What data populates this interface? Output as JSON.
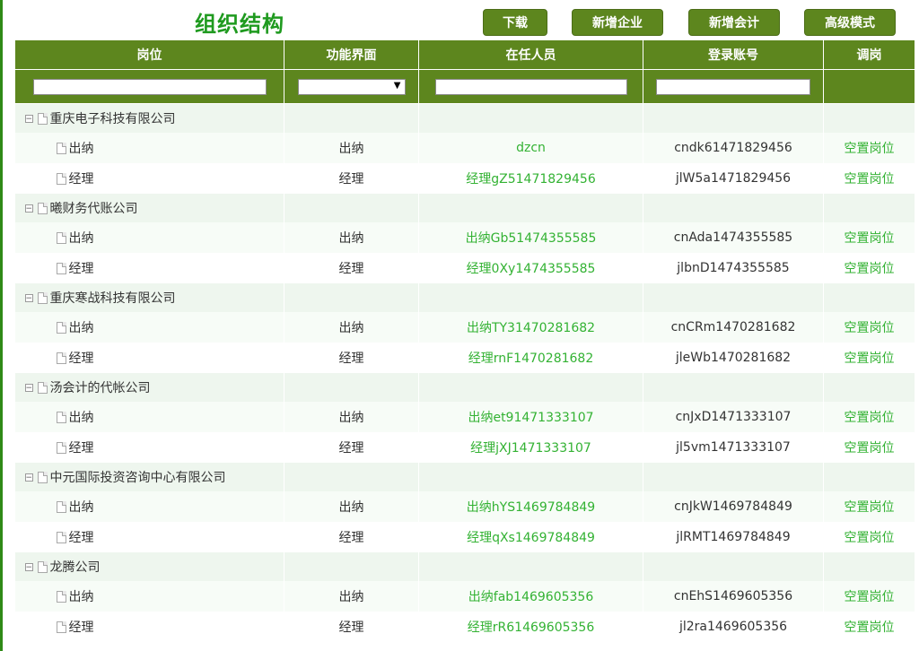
{
  "title": "组织结构",
  "toolbar": {
    "download": "下载",
    "new_company": "新增企业",
    "new_accountant": "新增会计",
    "advanced_mode": "高级模式"
  },
  "colors": {
    "header_bg": "#5d861e",
    "accent_green": "#33b233",
    "title_green": "#1f9a1f"
  },
  "columns": [
    "岗位",
    "功能界面",
    "在任人员",
    "登录账号",
    "调岗"
  ],
  "filters": {
    "position": "",
    "function": "",
    "staff": "",
    "account": ""
  },
  "icons": {
    "tree_toggle": "minus-box-icon",
    "node": "document-icon",
    "dropdown": "caret-down-icon"
  },
  "companies": [
    {
      "name": "重庆电子科技有限公司",
      "roles": [
        {
          "position": "出纳",
          "function": "出纳",
          "staff": "dzcn",
          "account": "cndk61471829456",
          "action": "空置岗位"
        },
        {
          "position": "经理",
          "function": "经理",
          "staff": "经理gZ51471829456",
          "account": "jlW5a1471829456",
          "action": "空置岗位"
        }
      ]
    },
    {
      "name": "曦财务代账公司",
      "roles": [
        {
          "position": "出纳",
          "function": "出纳",
          "staff": "出纳Gb51474355585",
          "account": "cnAda1474355585",
          "action": "空置岗位"
        },
        {
          "position": "经理",
          "function": "经理",
          "staff": "经理0Xy1474355585",
          "account": "jlbnD1474355585",
          "action": "空置岗位"
        }
      ]
    },
    {
      "name": "重庆寒战科技有限公司",
      "roles": [
        {
          "position": "出纳",
          "function": "出纳",
          "staff": "出纳TY31470281682",
          "account": "cnCRm1470281682",
          "action": "空置岗位"
        },
        {
          "position": "经理",
          "function": "经理",
          "staff": "经理rnF1470281682",
          "account": "jleWb1470281682",
          "action": "空置岗位"
        }
      ]
    },
    {
      "name": "汤会计的代帐公司",
      "roles": [
        {
          "position": "出纳",
          "function": "出纳",
          "staff": "出纳et91471333107",
          "account": "cnJxD1471333107",
          "action": "空置岗位"
        },
        {
          "position": "经理",
          "function": "经理",
          "staff": "经理jXJ1471333107",
          "account": "jl5vm1471333107",
          "action": "空置岗位"
        }
      ]
    },
    {
      "name": "中元国际投资咨询中心有限公司",
      "roles": [
        {
          "position": "出纳",
          "function": "出纳",
          "staff": "出纳hYS1469784849",
          "account": "cnJkW1469784849",
          "action": "空置岗位"
        },
        {
          "position": "经理",
          "function": "经理",
          "staff": "经理qXs1469784849",
          "account": "jlRMT1469784849",
          "action": "空置岗位"
        }
      ]
    },
    {
      "name": "龙腾公司",
      "roles": [
        {
          "position": "出纳",
          "function": "出纳",
          "staff": "出纳fab1469605356",
          "account": "cnEhS1469605356",
          "action": "空置岗位"
        },
        {
          "position": "经理",
          "function": "经理",
          "staff": "经理rR61469605356",
          "account": "jl2ra1469605356",
          "action": "空置岗位"
        }
      ]
    }
  ]
}
